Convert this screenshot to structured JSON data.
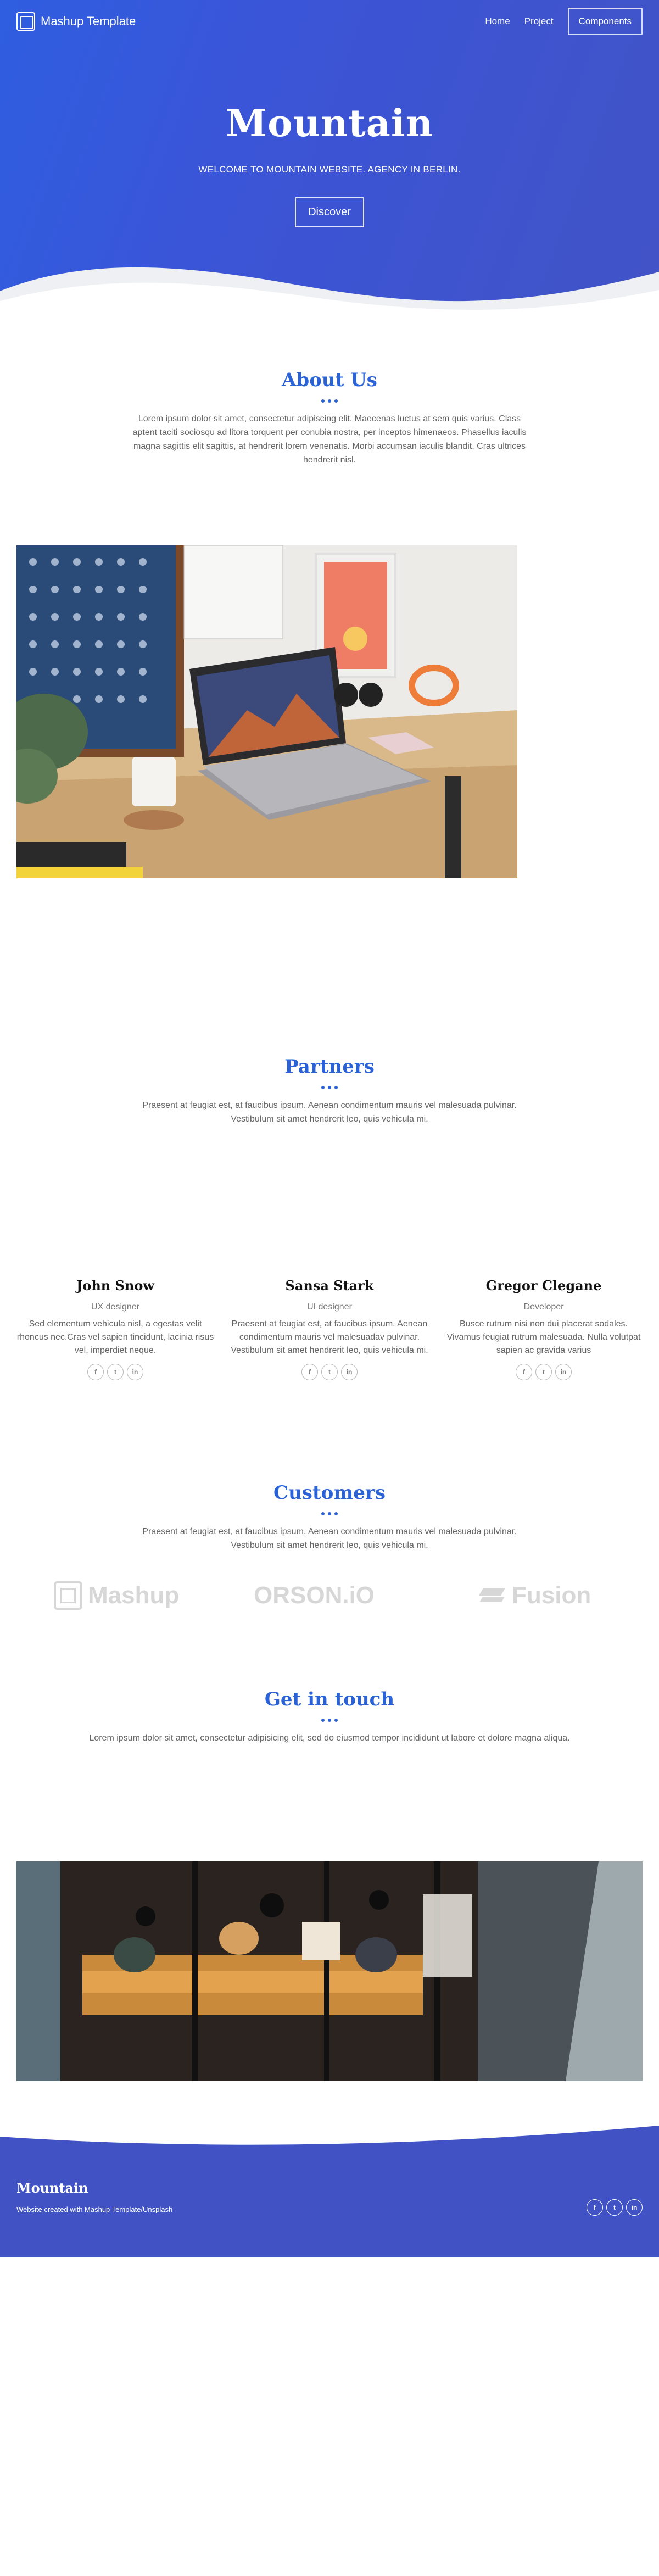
{
  "nav": {
    "brand": "Mashup Template",
    "links": [
      "Home",
      "Project"
    ],
    "cta": "Components"
  },
  "hero": {
    "title": "Mountain",
    "subtitle": "WELCOME TO MOUNTAIN WEBSITE. AGENCY IN BERLIN.",
    "button": "Discover"
  },
  "about": {
    "title": "About Us",
    "text": "Lorem ipsum dolor sit amet, consectetur adipiscing elit. Maecenas luctus at sem quis varius. Class aptent taciti sociosqu ad litora torquent per conubia nostra, per inceptos himenaeos. Phasellus iaculis magna sagittis elit sagittis, at hendrerit lorem venenatis. Morbi accumsan iaculis blandit. Cras ultrices hendrerit nisl."
  },
  "partners": {
    "title": "Partners",
    "text": "Praesent at feugiat est, at faucibus ipsum. Aenean condimentum mauris vel malesuada pulvinar. Vestibulum sit amet hendrerit leo, quis vehicula mi."
  },
  "team": [
    {
      "name": "John Snow",
      "role": "UX designer",
      "bio": "Sed elementum vehicula nisl, a egestas velit rhoncus nec.Cras vel sapien tincidunt, lacinia risus vel, imperdiet neque."
    },
    {
      "name": "Sansa Stark",
      "role": "UI designer",
      "bio": "Praesent at feugiat est, at faucibus ipsum. Aenean condimentum mauris vel malesuadav pulvinar. Vestibulum sit amet hendrerit leo, quis vehicula mi."
    },
    {
      "name": "Gregor Clegane",
      "role": "Developer",
      "bio": "Busce rutrum nisi non dui placerat sodales. Vivamus feugiat rutrum malesuada. Nulla volutpat sapien ac gravida varius"
    }
  ],
  "social_glyphs": {
    "facebook": "f",
    "twitter": "t",
    "linkedin": "in"
  },
  "customers": {
    "title": "Customers",
    "text": "Praesent at feugiat est, at faucibus ipsum. Aenean condimentum mauris vel malesuada pulvinar. Vestibulum sit amet hendrerit leo, quis vehicula mi.",
    "logos": [
      "Mashup",
      "ORSON.iO",
      "Fusion"
    ]
  },
  "contact": {
    "title": "Get in touch",
    "text": "Lorem ipsum dolor sit amet, consectetur adipisicing elit, sed do eiusmod tempor incididunt ut labore et dolore magna aliqua."
  },
  "footer": {
    "title": "Mountain",
    "note": "Website created with Mashup Template/Unsplash"
  },
  "colors": {
    "accent": "#2b63d6",
    "hero_start": "#2f5ee0",
    "hero_end": "#4253c6",
    "footer": "#4052c4"
  }
}
